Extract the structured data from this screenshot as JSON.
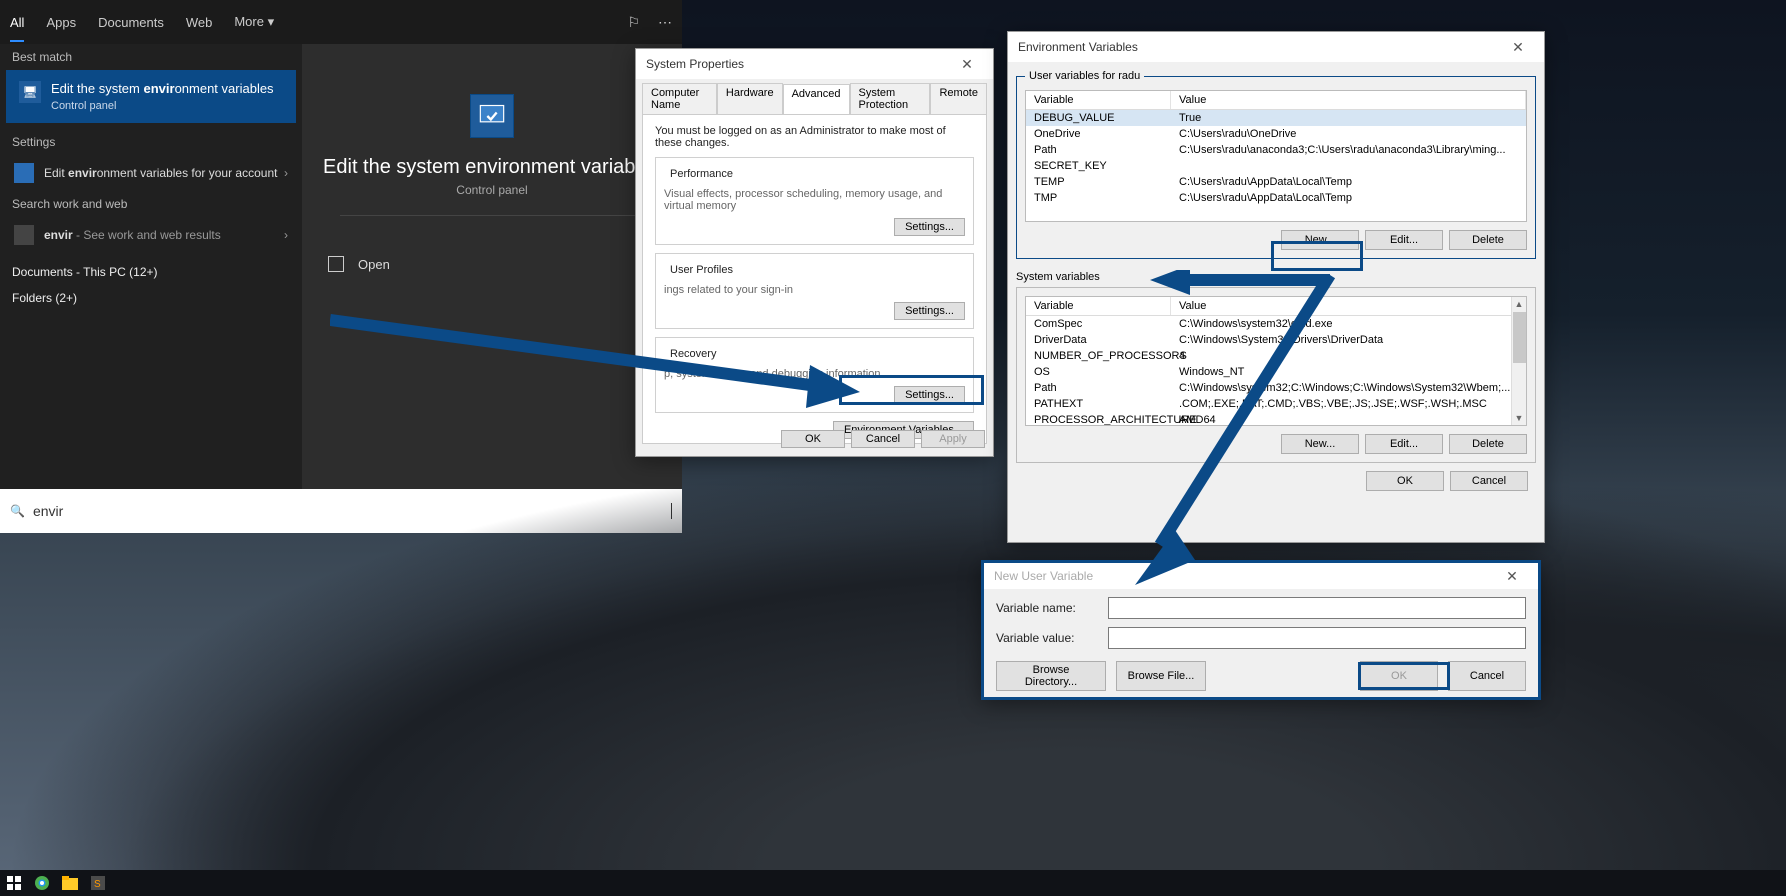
{
  "start": {
    "tabs": [
      "All",
      "Apps",
      "Documents",
      "Web",
      "More ▾"
    ],
    "active_tab": "All",
    "best_match_label": "Best match",
    "selected": {
      "title_prefix": "Edit the system ",
      "title_bold": "envir",
      "title_suffix": "onment variables",
      "sub": "Control panel"
    },
    "settings_label": "Settings",
    "settings_item_prefix": "Edit ",
    "settings_item_bold": "envir",
    "settings_item_suffix": "onment variables for your account",
    "search_web_label": "Search work and web",
    "search_web_item_bold": "envir",
    "search_web_item_suffix": " - See work and web results",
    "docs_label": "Documents - This PC (12+)",
    "folders_label": "Folders (2+)",
    "right_title": "Edit the system environment variables",
    "right_sub": "Control panel",
    "open_label": "Open",
    "search_value": "envir"
  },
  "sysprop": {
    "title": "System Properties",
    "tabs": [
      "Computer Name",
      "Hardware",
      "Advanced",
      "System Protection",
      "Remote"
    ],
    "active_tab": "Advanced",
    "admin_note": "You must be logged on as an Administrator to make most of these changes.",
    "perf": {
      "title": "Performance",
      "desc": "Visual effects, processor scheduling, memory usage, and virtual memory",
      "btn": "Settings..."
    },
    "profiles": {
      "title": "User Profiles",
      "desc": "ings related to your sign-in",
      "btn": "Settings..."
    },
    "startup": {
      "title": "Recovery",
      "desc": "p, system failure, and debugging information",
      "btn": "Settings..."
    },
    "envbtn": "Environment Variables...",
    "ok": "OK",
    "cancel": "Cancel",
    "apply": "Apply"
  },
  "envvar": {
    "title": "Environment Variables",
    "user_group": "User variables for radu",
    "sys_group": "System variables",
    "head_var": "Variable",
    "head_val": "Value",
    "user_rows": [
      {
        "var": "DEBUG_VALUE",
        "val": "True"
      },
      {
        "var": "OneDrive",
        "val": "C:\\Users\\radu\\OneDrive"
      },
      {
        "var": "Path",
        "val": "C:\\Users\\radu\\anaconda3;C:\\Users\\radu\\anaconda3\\Library\\ming..."
      },
      {
        "var": "SECRET_KEY",
        "val": ""
      },
      {
        "var": "TEMP",
        "val": "C:\\Users\\radu\\AppData\\Local\\Temp"
      },
      {
        "var": "TMP",
        "val": "C:\\Users\\radu\\AppData\\Local\\Temp"
      }
    ],
    "sys_rows": [
      {
        "var": "ComSpec",
        "val": "C:\\Windows\\system32\\cmd.exe"
      },
      {
        "var": "DriverData",
        "val": "C:\\Windows\\System32\\Drivers\\DriverData"
      },
      {
        "var": "NUMBER_OF_PROCESSORS",
        "val": "4"
      },
      {
        "var": "OS",
        "val": "Windows_NT"
      },
      {
        "var": "Path",
        "val": "C:\\Windows\\system32;C:\\Windows;C:\\Windows\\System32\\Wbem;..."
      },
      {
        "var": "PATHEXT",
        "val": ".COM;.EXE;.BAT;.CMD;.VBS;.VBE;.JS;.JSE;.WSF;.WSH;.MSC"
      },
      {
        "var": "PROCESSOR_ARCHITECTURE",
        "val": "AMD64"
      }
    ],
    "btn_new": "New...",
    "btn_edit": "Edit...",
    "btn_del": "Delete",
    "ok": "OK",
    "cancel": "Cancel"
  },
  "newvar": {
    "title": "New User Variable",
    "name_label": "Variable name:",
    "value_label": "Variable value:",
    "browse_dir": "Browse Directory...",
    "browse_file": "Browse File...",
    "ok": "OK",
    "cancel": "Cancel"
  }
}
